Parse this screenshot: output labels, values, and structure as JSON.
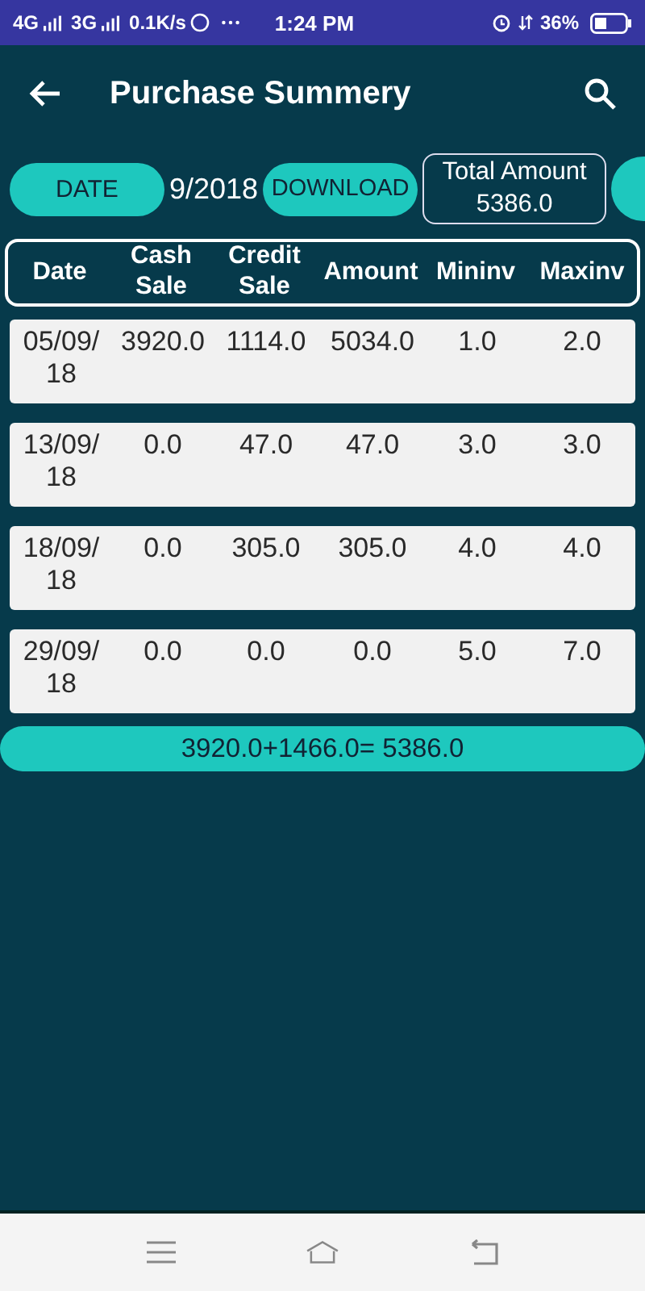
{
  "status_bar": {
    "network_1": "4G",
    "network_2": "3G",
    "speed": "0.1K/s",
    "time": "1:24 PM",
    "battery": "36%"
  },
  "app_bar": {
    "title": "Purchase Summery"
  },
  "toolbar": {
    "date_button": "DATE",
    "date_value": "9/2018",
    "download_button": "DOWNLOAD",
    "total_label": "Total Amount",
    "total_value": "5386.0"
  },
  "table": {
    "columns": [
      "Date",
      "Cash Sale",
      "Credit Sale",
      "Amount",
      "Mininv",
      "Maxinv"
    ],
    "rows": [
      [
        "05/09/18",
        "3920.0",
        "1114.0",
        "5034.0",
        "1.0",
        "2.0"
      ],
      [
        "13/09/18",
        "0.0",
        "47.0",
        "47.0",
        "3.0",
        "3.0"
      ],
      [
        "18/09/18",
        "0.0",
        "305.0",
        "305.0",
        "4.0",
        "4.0"
      ],
      [
        "29/09/18",
        "0.0",
        "0.0",
        "0.0",
        "5.0",
        "7.0"
      ]
    ]
  },
  "summary": "3920.0+1466.0= 5386.0"
}
